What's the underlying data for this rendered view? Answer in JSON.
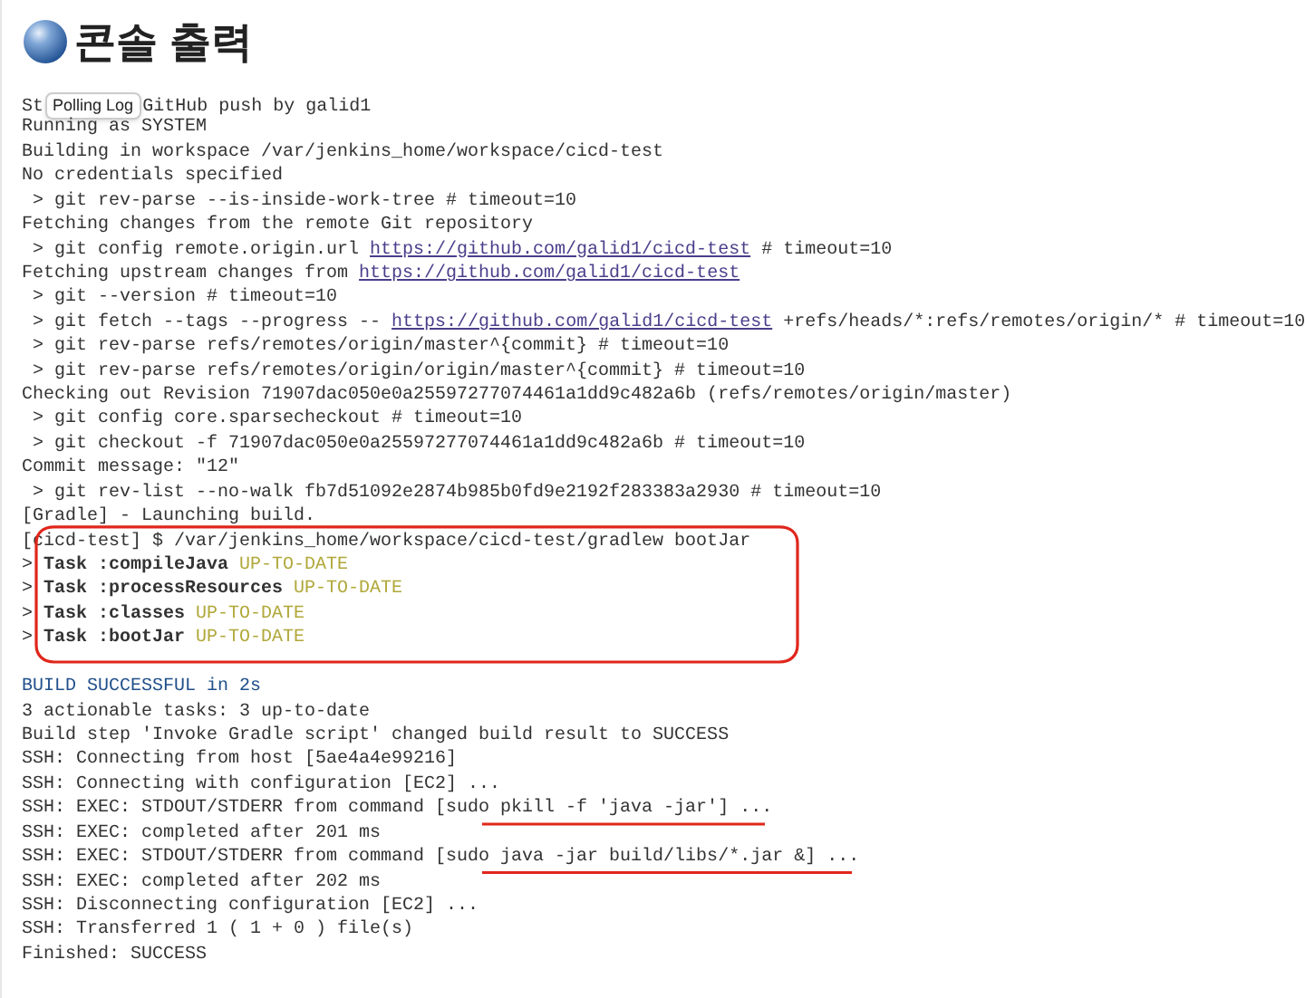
{
  "title": "콘솔 출력",
  "log": [
    {
      "segments": [
        {
          "kind": "text",
          "text": "St"
        },
        {
          "kind": "tooltip",
          "text": "Polling Log"
        },
        {
          "kind": "text",
          "text": "GitHub push by galid1"
        }
      ]
    },
    {
      "segments": [
        {
          "kind": "text",
          "text": "Running as SYSTEM"
        }
      ]
    },
    {
      "segments": [
        {
          "kind": "text",
          "text": "Building in workspace /var/jenkins_home/workspace/cicd-test"
        }
      ]
    },
    {
      "segments": [
        {
          "kind": "text",
          "text": "No credentials specified"
        }
      ]
    },
    {
      "segments": [
        {
          "kind": "text",
          "text": " > git rev-parse --is-inside-work-tree # timeout=10"
        }
      ]
    },
    {
      "segments": [
        {
          "kind": "text",
          "text": "Fetching changes from the remote Git repository"
        }
      ]
    },
    {
      "segments": [
        {
          "kind": "text",
          "text": " > git config remote.origin.url "
        },
        {
          "kind": "link",
          "text": "https://github.com/galid1/cicd-test"
        },
        {
          "kind": "text",
          "text": " # timeout=10"
        }
      ]
    },
    {
      "segments": [
        {
          "kind": "text",
          "text": "Fetching upstream changes from "
        },
        {
          "kind": "link",
          "text": "https://github.com/galid1/cicd-test"
        }
      ]
    },
    {
      "segments": [
        {
          "kind": "text",
          "text": " > git --version # timeout=10"
        }
      ]
    },
    {
      "segments": [
        {
          "kind": "text",
          "text": " > git fetch --tags --progress -- "
        },
        {
          "kind": "link",
          "text": "https://github.com/galid1/cicd-test"
        },
        {
          "kind": "text",
          "text": " +refs/heads/*:refs/remotes/origin/* # timeout=10"
        }
      ]
    },
    {
      "segments": [
        {
          "kind": "text",
          "text": " > git rev-parse refs/remotes/origin/master^{commit} # timeout=10"
        }
      ]
    },
    {
      "segments": [
        {
          "kind": "text",
          "text": " > git rev-parse refs/remotes/origin/origin/master^{commit} # timeout=10"
        }
      ]
    },
    {
      "segments": [
        {
          "kind": "text",
          "text": "Checking out Revision 71907dac050e0a25597277074461a1dd9c482a6b (refs/remotes/origin/master)"
        }
      ]
    },
    {
      "segments": [
        {
          "kind": "text",
          "text": " > git config core.sparsecheckout # timeout=10"
        }
      ]
    },
    {
      "segments": [
        {
          "kind": "text",
          "text": " > git checkout -f 71907dac050e0a25597277074461a1dd9c482a6b # timeout=10"
        }
      ]
    },
    {
      "segments": [
        {
          "kind": "text",
          "text": "Commit message: \"12\""
        }
      ]
    },
    {
      "segments": [
        {
          "kind": "text",
          "text": " > git rev-list --no-walk fb7d51092e2874b985b0fd9e2192f283383a2930 # timeout=10"
        }
      ]
    },
    {
      "segments": [
        {
          "kind": "text",
          "text": "[Gradle] - Launching build."
        }
      ]
    },
    {
      "segments": [
        {
          "kind": "text",
          "text": "[cicd-test] $ /var/jenkins_home/workspace/cicd-test/gradlew bootJar"
        }
      ]
    },
    {
      "segments": [
        {
          "kind": "text",
          "text": "> "
        },
        {
          "kind": "bold",
          "text": "Task :compileJava"
        },
        {
          "kind": "status",
          "text": " UP-TO-DATE"
        }
      ]
    },
    {
      "segments": [
        {
          "kind": "text",
          "text": "> "
        },
        {
          "kind": "bold",
          "text": "Task :processResources"
        },
        {
          "kind": "status",
          "text": " UP-TO-DATE"
        }
      ]
    },
    {
      "segments": [
        {
          "kind": "text",
          "text": "> "
        },
        {
          "kind": "bold",
          "text": "Task :classes"
        },
        {
          "kind": "status",
          "text": " UP-TO-DATE"
        }
      ]
    },
    {
      "segments": [
        {
          "kind": "text",
          "text": "> "
        },
        {
          "kind": "bold",
          "text": "Task :bootJar"
        },
        {
          "kind": "status",
          "text": " UP-TO-DATE"
        }
      ]
    },
    {
      "kind": "blank"
    },
    {
      "segments": [
        {
          "kind": "result",
          "text": "BUILD SUCCESSFUL in 2s"
        }
      ]
    },
    {
      "segments": [
        {
          "kind": "text",
          "text": "3 actionable tasks: 3 up-to-date"
        }
      ]
    },
    {
      "segments": [
        {
          "kind": "text",
          "text": "Build step 'Invoke Gradle script' changed build result to SUCCESS"
        }
      ]
    },
    {
      "segments": [
        {
          "kind": "text",
          "text": "SSH: Connecting from host [5ae4a4e99216]"
        }
      ]
    },
    {
      "segments": [
        {
          "kind": "text",
          "text": "SSH: Connecting with configuration [EC2] ..."
        }
      ]
    },
    {
      "segments": [
        {
          "kind": "text",
          "text": "SSH: EXEC: STDOUT/STDERR from command [sudo pkill -f 'java -jar'] ..."
        }
      ]
    },
    {
      "segments": [
        {
          "kind": "text",
          "text": "SSH: EXEC: completed after 201 ms"
        }
      ]
    },
    {
      "segments": [
        {
          "kind": "text",
          "text": "SSH: EXEC: STDOUT/STDERR from command [sudo java -jar build/libs/*.jar &] ..."
        }
      ]
    },
    {
      "segments": [
        {
          "kind": "text",
          "text": "SSH: EXEC: completed after 202 ms"
        }
      ]
    },
    {
      "segments": [
        {
          "kind": "text",
          "text": "SSH: Disconnecting configuration [EC2] ..."
        }
      ]
    },
    {
      "segments": [
        {
          "kind": "text",
          "text": "SSH: Transferred 1 ( 1 + 0 ) file(s)"
        }
      ]
    },
    {
      "segments": [
        {
          "kind": "text",
          "text": "Finished: SUCCESS"
        }
      ]
    }
  ]
}
